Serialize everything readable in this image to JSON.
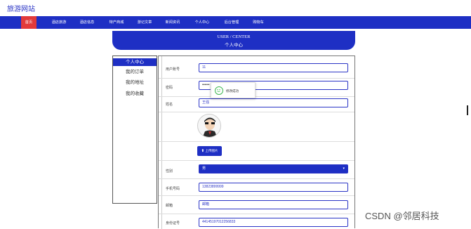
{
  "site": {
    "title": "旅游网站"
  },
  "nav": {
    "items": [
      {
        "label": "首页",
        "active": true
      },
      {
        "label": "酒店旅游"
      },
      {
        "label": "酒店信息"
      },
      {
        "label": "特产商城"
      },
      {
        "label": "游记文章"
      },
      {
        "label": "新闻资讯"
      },
      {
        "label": "个人中心"
      },
      {
        "label": "后台管理"
      },
      {
        "label": "购物车"
      }
    ]
  },
  "banner": {
    "title_en": "USER / CENTER",
    "title_cn": "个人中心"
  },
  "sidebar": {
    "items": [
      {
        "label": "个人中心",
        "active": true
      },
      {
        "label": "我的订单"
      },
      {
        "label": "我的地址"
      },
      {
        "label": "我的收藏"
      }
    ]
  },
  "form": {
    "account": {
      "label": "用户账号",
      "value": "11"
    },
    "password": {
      "label": "密码",
      "value": "••••••"
    },
    "name": {
      "label": "姓名",
      "value": "王强"
    },
    "upload_label": "上传图片",
    "gender": {
      "label": "性别",
      "value": "男"
    },
    "phone": {
      "label": "手机号码",
      "value": "13823899999"
    },
    "email": {
      "label": "邮箱",
      "value": "邮箱"
    },
    "idcard": {
      "label": "身份证号",
      "value": "441451970122568​33"
    }
  },
  "toast": {
    "message": "修改成功"
  },
  "watermark": "CSDN @邻居科技",
  "colors": {
    "primary": "#1e2fc4",
    "active_nav": "#e23a3a",
    "success": "#3db851"
  }
}
